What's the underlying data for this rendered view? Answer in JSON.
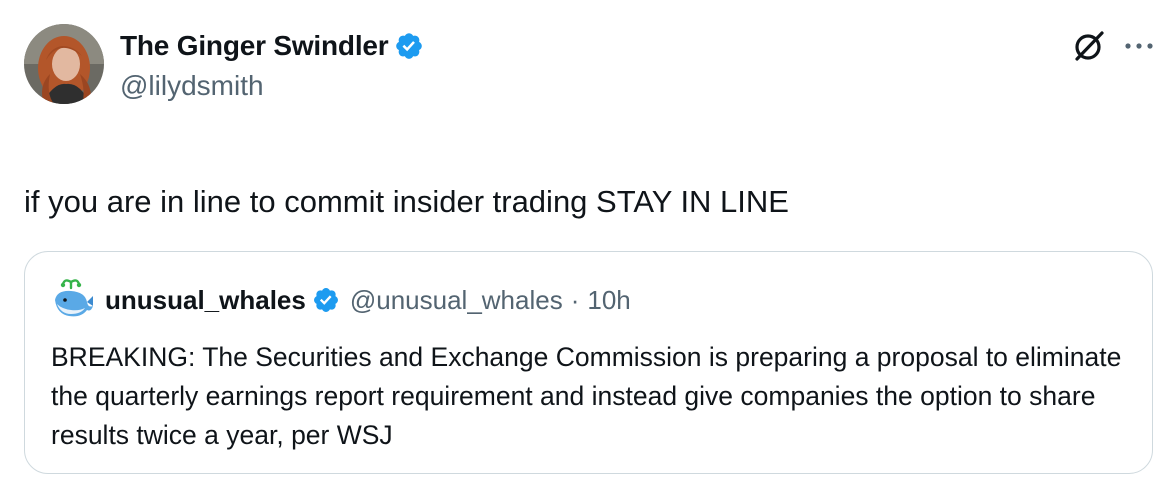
{
  "author": {
    "display_name": "The Ginger Swindler",
    "handle": "@lilydsmith",
    "verified": true,
    "avatar": "user-avatar-photo"
  },
  "actions": {
    "grok_icon": "grok-icon",
    "more_icon": "more-icon"
  },
  "tweet": {
    "text": "if you are in line to commit insider trading STAY IN LINE"
  },
  "quote": {
    "display_name": "unusual_whales",
    "handle": "@unusual_whales",
    "separator": "·",
    "time": "10h",
    "verified": true,
    "avatar": "whale-avatar",
    "text": "BREAKING: The Securities and Exchange Commission is preparing a proposal to eliminate the quarterly earnings report requirement and instead give companies the option to share results twice a year, per WSJ"
  },
  "colors": {
    "text_primary": "#0f1419",
    "text_secondary": "#536471",
    "verified_blue": "#1d9bf0",
    "border": "#cfd9de"
  }
}
